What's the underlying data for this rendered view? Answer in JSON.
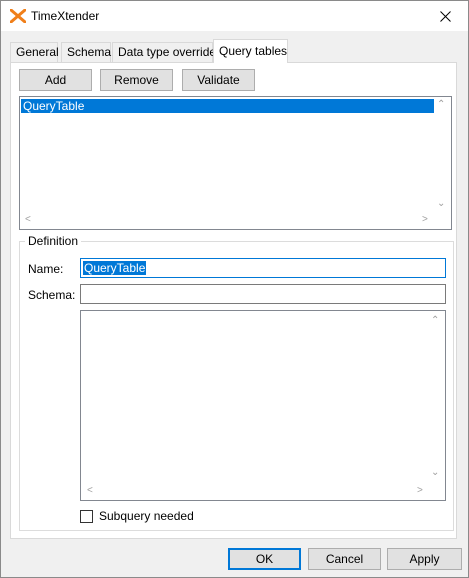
{
  "window": {
    "title": "TimeXtender",
    "accent_color": "#0078d7",
    "brand_icon_color": "#f07f1a"
  },
  "tabs": [
    {
      "label": "General",
      "active": false
    },
    {
      "label": "Schema",
      "active": false
    },
    {
      "label": "Data type overrides",
      "active": false
    },
    {
      "label": "Query tables",
      "active": true
    }
  ],
  "toolbar": {
    "add_label": "Add",
    "remove_label": "Remove",
    "validate_label": "Validate"
  },
  "query_tables": {
    "items": [
      "QueryTable"
    ],
    "selected_index": 0
  },
  "definition": {
    "group_label": "Definition",
    "name_label": "Name:",
    "name_value": "QueryTable",
    "schema_label": "Schema:",
    "schema_value": "",
    "query_text": "",
    "subquery_label": "Subquery needed",
    "subquery_checked": false
  },
  "footer": {
    "ok_label": "OK",
    "cancel_label": "Cancel",
    "apply_label": "Apply"
  }
}
